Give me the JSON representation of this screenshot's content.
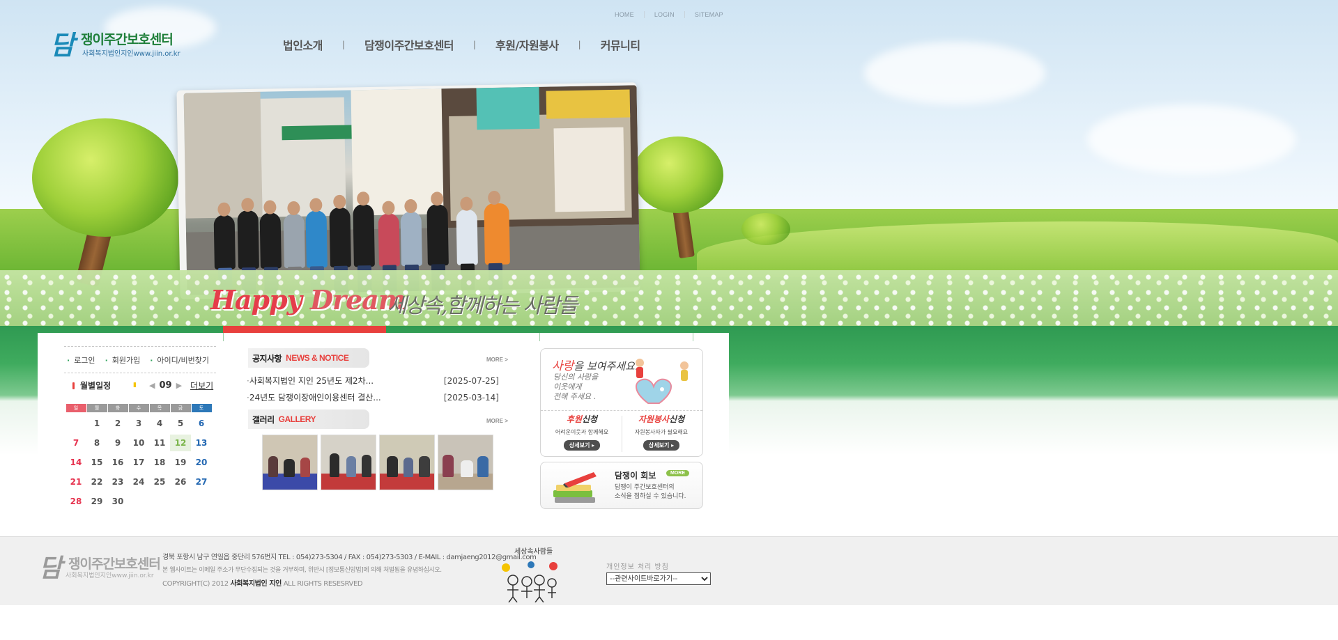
{
  "utility_links": [
    "HOME",
    "LOGIN",
    "SITEMAP"
  ],
  "logo": {
    "mark": "담",
    "title": "쟁이주간보호센터",
    "subtitle": "사회복지법인지인www.jiin.or.kr"
  },
  "gnb": [
    "법인소개",
    "담쟁이주간보호센터",
    "후원/자원봉사",
    "커뮤니티"
  ],
  "hero": {
    "slogan_en_1": "Happy",
    "slogan_en_2": "Dream",
    "slogan_kr": "세상속,함께하는 사람들"
  },
  "login_links": [
    "로그인",
    "회원가입",
    "아이디/비번찾기"
  ],
  "calendar": {
    "title": "월별일정",
    "month": "09",
    "more_label": "더보기",
    "weekdays": [
      "일",
      "월",
      "화",
      "수",
      "목",
      "금",
      "토"
    ],
    "weeks": [
      [
        "",
        "1",
        "2",
        "3",
        "4",
        "5",
        "6"
      ],
      [
        "7",
        "8",
        "9",
        "10",
        "11",
        "12",
        "13"
      ],
      [
        "14",
        "15",
        "16",
        "17",
        "18",
        "19",
        "20"
      ],
      [
        "21",
        "22",
        "23",
        "24",
        "25",
        "26",
        "27"
      ],
      [
        "28",
        "29",
        "30",
        "",
        "",
        "",
        ""
      ]
    ],
    "today": "12"
  },
  "notice": {
    "title_ko": "공지사항",
    "title_en": "NEWS & NOTICE",
    "more": "MORE >",
    "items": [
      {
        "title": "사회복지법인 지인 25년도 제2차...",
        "date": "[2025-07-25]"
      },
      {
        "title": "24년도 담쟁이장애인이용센터 결산...",
        "date": "[2025-03-14]"
      }
    ]
  },
  "gallery": {
    "title_ko": "갤러리",
    "title_en": "GALLERY",
    "more": "MORE >"
  },
  "love_banner": {
    "title_hl": "사랑",
    "title_rest": "을 보여주세요.",
    "line1": "당신의 사랑을",
    "line2": "이웃에게",
    "line3": "전해 주세요 .",
    "sponsor_hl": "후원",
    "sponsor_rest": "신청",
    "sponsor_desc": "어려운이웃과 함께해요",
    "sponsor_btn": "상세보기 ▸",
    "volunteer_hl": "자원봉사",
    "volunteer_rest": "신청",
    "volunteer_desc": "자원봉사자가 필요해요",
    "volunteer_btn": "상세보기 ▸"
  },
  "newsletter_banner": {
    "title": "담쟁이 회보",
    "badge": "MORE",
    "line1": "담쟁이 주간보호센터의",
    "line2": "소식을 접하실 수 있습니다."
  },
  "footer": {
    "logo_mark": "담",
    "logo_title": "쟁이주간보호센터",
    "logo_sub": "사회복지법인지인www.jiin.or.kr",
    "address_line": "경북 포항시 남구 연일읍 중단리 576번지  TEL : 054)273-5304 / FAX : 054)273-5303 / E-MAIL : damjaeng2012@gmail.com",
    "policy_line": "본 웹사이트는 이메일 주소가 무단수집되는 것을 거부하며, 위반시 [정보통신망법]에 의해 처벌됨을 유념하십시오.",
    "copyright_pre": "COPYRIGHT(C) 2012 ",
    "copyright_org": "사회복지법인 지인",
    "copyright_post": "  ALL RIGHTS RESESRVED",
    "mascot_text": "세상속사람들",
    "privacy": "개인정보 처리 방침",
    "related_select": "--관련사이트바로가기--"
  },
  "colors": {
    "brand_green": "#2f9a52",
    "accent_red": "#e8403d",
    "saturday_blue": "#2d78b8",
    "sunday_red": "#e95f6c"
  }
}
